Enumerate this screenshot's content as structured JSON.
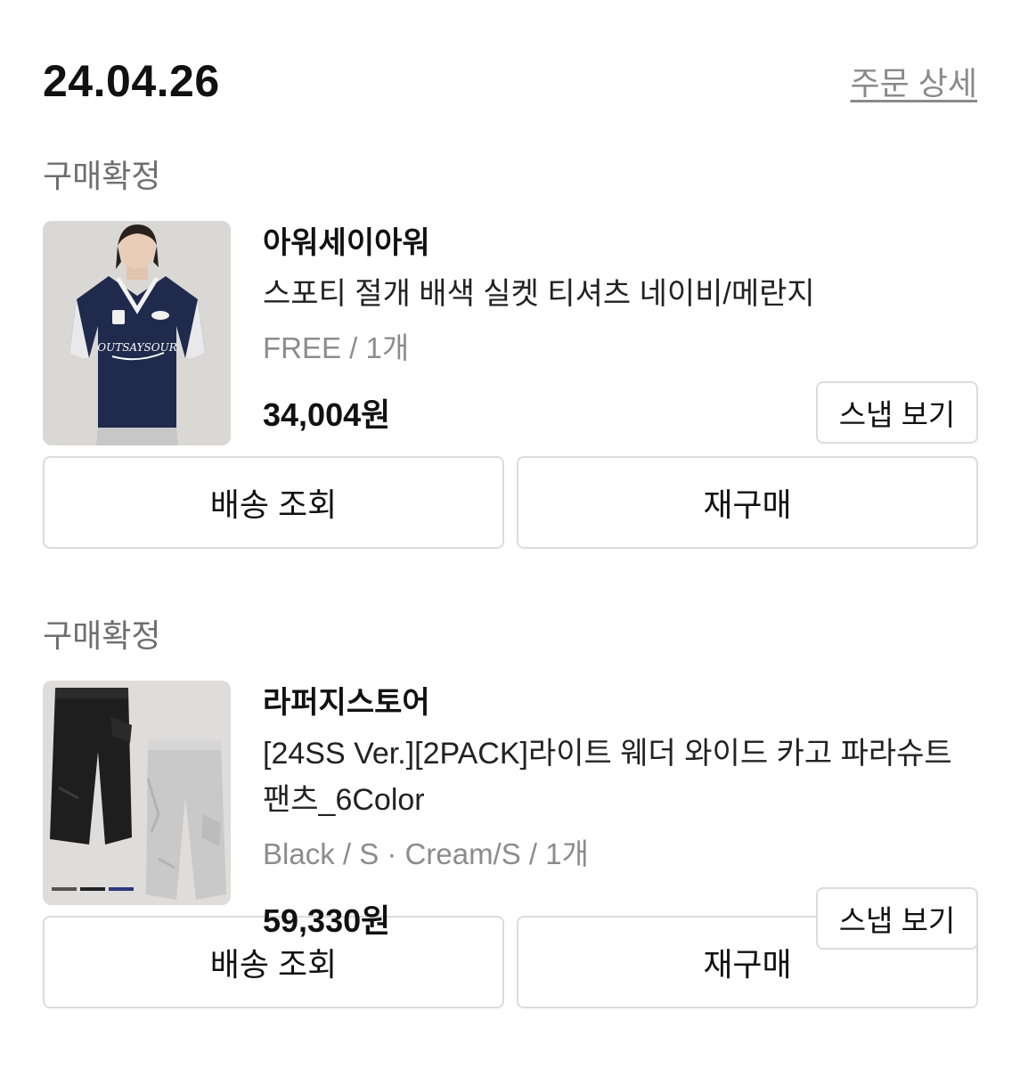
{
  "order": {
    "date": "24.04.26",
    "detail_link": "주문 상세"
  },
  "items": [
    {
      "status": "구매확정",
      "brand": "아워세이아워",
      "name": "스포티 절개 배색 실켓 티셔츠 네이비/메란지",
      "option": "FREE / 1개",
      "price": "34,004원",
      "snap_label": "스냅 보기",
      "delivery_label": "배송 조회",
      "rebuy_label": "재구매",
      "thumb_print": "OUTSAYSOUR"
    },
    {
      "status": "구매확정",
      "brand": "라퍼지스토어",
      "name": "[24SS Ver.][2PACK]라이트 웨더 와이드 카고 파라슈트 팬츠_6Color",
      "option": "Black / S · Cream/S / 1개",
      "price": "59,330원",
      "snap_label": "스냅 보기",
      "delivery_label": "배송 조회",
      "rebuy_label": "재구매"
    }
  ],
  "colors": {
    "text_primary": "#111111",
    "text_secondary": "#8c8c8c",
    "border": "#dcdcdc",
    "navy": "#1f2a4d"
  }
}
